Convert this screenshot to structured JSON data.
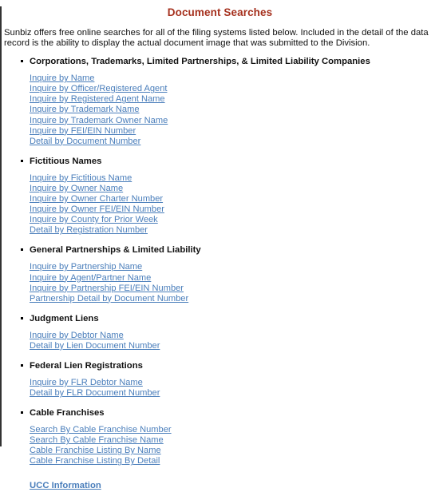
{
  "page": {
    "title": "Document Searches",
    "intro": "Sunbiz offers free online searches for all of the filing systems listed below. Included in the detail of the data record is the ability to display the actual document image that was submitted to the Division.",
    "title_color": "#a5301d",
    "link_color": "#4a7ebb",
    "text_color": "#111111"
  },
  "sections": [
    {
      "heading": "Corporations, Trademarks, Limited Partnerships, & Limited Liability Companies",
      "links": [
        "Inquire by Name",
        "Inquire by Officer/Registered Agent",
        "Inquire by Registered Agent Name",
        "Inquire by Trademark Name",
        "Inquire by Trademark Owner Name",
        "Inquire by FEI/EIN Number",
        "Detail by Document Number"
      ]
    },
    {
      "heading": "Fictitious Names",
      "links": [
        "Inquire by Fictitious Name",
        "Inquire by Owner Name",
        "Inquire by Owner Charter Number",
        "Inquire by Owner FEI/EIN Number",
        "Inquire by County for Prior Week",
        "Detail by Registration Number"
      ]
    },
    {
      "heading": "General Partnerships & Limited Liability",
      "links": [
        "Inquire by Partnership Name",
        "Inquire by Agent/Partner Name",
        "Inquire by Partnership FEI/EIN Number",
        "Partnership Detail by Document Number"
      ]
    },
    {
      "heading": "Judgment Liens",
      "links": [
        "Inquire by Debtor Name",
        "Detail by Lien Document Number"
      ]
    },
    {
      "heading": "Federal Lien Registrations",
      "links": [
        "Inquire by FLR Debtor Name",
        "Detail by FLR Document Number"
      ]
    },
    {
      "heading": "Cable Franchises",
      "links": [
        "Search By Cable Franchise Number",
        "Search By Cable Franchise Name",
        "Cable Franchise Listing By Name",
        "Cable Franchise Listing By Detail"
      ]
    }
  ],
  "footer": {
    "ucc_link": "UCC Information"
  }
}
